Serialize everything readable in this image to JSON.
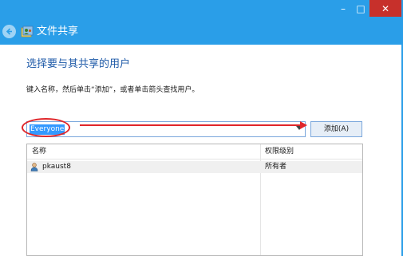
{
  "window": {
    "minimize_symbol": "–",
    "maximize_symbol": "□",
    "close_symbol": "✕",
    "accent_color": "#2a9ee8",
    "close_color": "#c7302b"
  },
  "header": {
    "title": "文件共享",
    "back_icon": "back-arrow-icon",
    "wizard_icon": "share-wizard-icon"
  },
  "main": {
    "heading": "选择要与其共享的用户",
    "instruction": "键入名称，然后单击“添加”，或者单击箭头查找用户。",
    "combo_value": "Everyone",
    "add_button_label": "添加(A)"
  },
  "table": {
    "columns": [
      "名称",
      "权限级别"
    ],
    "rows": [
      {
        "name": "pkaust8",
        "permission": "所有者",
        "icon": "user-icon"
      }
    ]
  },
  "annotation": {
    "color": "#e0262a"
  }
}
